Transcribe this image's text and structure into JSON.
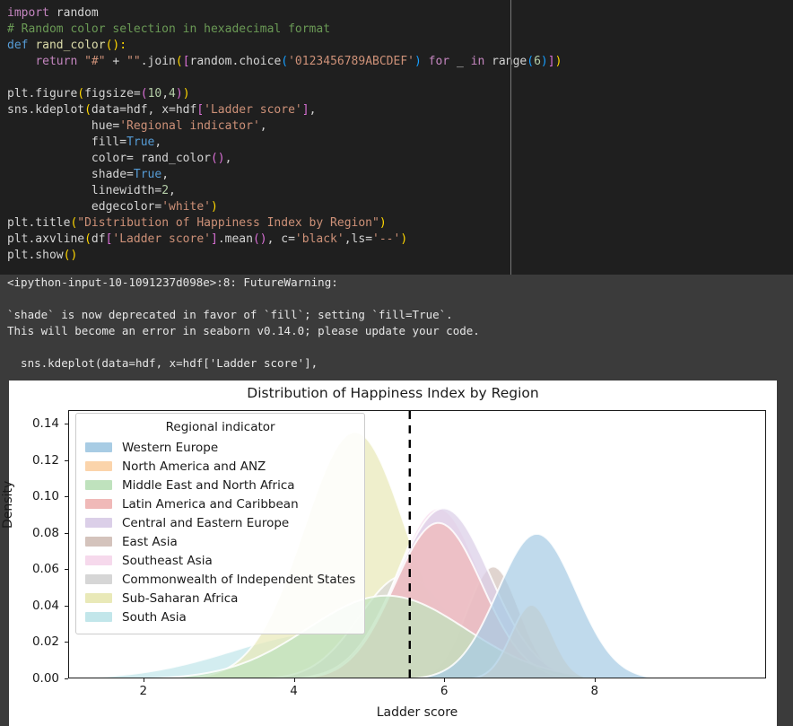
{
  "code_cell": {
    "lines": [
      [
        {
          "t": "import ",
          "c": "tok-kw2"
        },
        {
          "t": "random",
          "c": "tok-plain"
        }
      ],
      [
        {
          "t": "# Random color selection in hexadecimal format",
          "c": "tok-com"
        }
      ],
      [
        {
          "t": "def ",
          "c": "tok-kw"
        },
        {
          "t": "rand_color",
          "c": "tok-fn"
        },
        {
          "t": "():",
          "c": "tok-par1"
        }
      ],
      [
        {
          "t": "    ",
          "c": "tok-plain"
        },
        {
          "t": "return ",
          "c": "tok-kw2"
        },
        {
          "t": "\"#\"",
          "c": "tok-str"
        },
        {
          "t": " + ",
          "c": "tok-plain"
        },
        {
          "t": "\"\"",
          "c": "tok-str"
        },
        {
          "t": ".join",
          "c": "tok-plain"
        },
        {
          "t": "(",
          "c": "tok-par1"
        },
        {
          "t": "[",
          "c": "tok-par2"
        },
        {
          "t": "random.choice",
          "c": "tok-plain"
        },
        {
          "t": "(",
          "c": "tok-par3"
        },
        {
          "t": "'0123456789ABCDEF'",
          "c": "tok-str"
        },
        {
          "t": ")",
          "c": "tok-par3"
        },
        {
          "t": " for ",
          "c": "tok-kw2"
        },
        {
          "t": "_ ",
          "c": "tok-plain"
        },
        {
          "t": "in ",
          "c": "tok-kw2"
        },
        {
          "t": "range",
          "c": "tok-plain"
        },
        {
          "t": "(",
          "c": "tok-par3"
        },
        {
          "t": "6",
          "c": "tok-num"
        },
        {
          "t": ")",
          "c": "tok-par3"
        },
        {
          "t": "]",
          "c": "tok-par2"
        },
        {
          "t": ")",
          "c": "tok-par1"
        }
      ],
      [
        {
          "t": "",
          "c": "tok-plain"
        }
      ],
      [
        {
          "t": "plt.figure",
          "c": "tok-plain"
        },
        {
          "t": "(",
          "c": "tok-par1"
        },
        {
          "t": "figsize=",
          "c": "tok-plain"
        },
        {
          "t": "(",
          "c": "tok-par2"
        },
        {
          "t": "10",
          "c": "tok-num"
        },
        {
          "t": ",",
          "c": "tok-plain"
        },
        {
          "t": "4",
          "c": "tok-num"
        },
        {
          "t": ")",
          "c": "tok-par2"
        },
        {
          "t": ")",
          "c": "tok-par1"
        }
      ],
      [
        {
          "t": "sns.kdeplot",
          "c": "tok-plain"
        },
        {
          "t": "(",
          "c": "tok-par1"
        },
        {
          "t": "data=hdf, x=hdf",
          "c": "tok-plain"
        },
        {
          "t": "[",
          "c": "tok-par2"
        },
        {
          "t": "'Ladder score'",
          "c": "tok-str"
        },
        {
          "t": "]",
          "c": "tok-par2"
        },
        {
          "t": ",",
          "c": "tok-plain"
        }
      ],
      [
        {
          "t": "            hue=",
          "c": "tok-plain"
        },
        {
          "t": "'Regional indicator'",
          "c": "tok-str"
        },
        {
          "t": ",",
          "c": "tok-plain"
        }
      ],
      [
        {
          "t": "            fill=",
          "c": "tok-plain"
        },
        {
          "t": "True",
          "c": "tok-blue"
        },
        {
          "t": ",",
          "c": "tok-plain"
        }
      ],
      [
        {
          "t": "            color= rand_color",
          "c": "tok-plain"
        },
        {
          "t": "()",
          "c": "tok-par2"
        },
        {
          "t": ",",
          "c": "tok-plain"
        }
      ],
      [
        {
          "t": "            shade=",
          "c": "tok-plain"
        },
        {
          "t": "True",
          "c": "tok-blue"
        },
        {
          "t": ",",
          "c": "tok-plain"
        }
      ],
      [
        {
          "t": "            linewidth=",
          "c": "tok-plain"
        },
        {
          "t": "2",
          "c": "tok-num"
        },
        {
          "t": ",",
          "c": "tok-plain"
        }
      ],
      [
        {
          "t": "            edgecolor=",
          "c": "tok-plain"
        },
        {
          "t": "'white'",
          "c": "tok-str"
        },
        {
          "t": ")",
          "c": "tok-par1"
        }
      ],
      [
        {
          "t": "plt.title",
          "c": "tok-plain"
        },
        {
          "t": "(",
          "c": "tok-par1"
        },
        {
          "t": "\"Distribution of Happiness Index by Region\"",
          "c": "tok-str"
        },
        {
          "t": ")",
          "c": "tok-par1"
        }
      ],
      [
        {
          "t": "plt.axvline",
          "c": "tok-plain"
        },
        {
          "t": "(",
          "c": "tok-par1"
        },
        {
          "t": "df",
          "c": "tok-plain"
        },
        {
          "t": "[",
          "c": "tok-par2"
        },
        {
          "t": "'Ladder score'",
          "c": "tok-str"
        },
        {
          "t": "]",
          "c": "tok-par2"
        },
        {
          "t": ".mean",
          "c": "tok-plain"
        },
        {
          "t": "()",
          "c": "tok-par2"
        },
        {
          "t": ", c=",
          "c": "tok-plain"
        },
        {
          "t": "'black'",
          "c": "tok-str"
        },
        {
          "t": ",ls=",
          "c": "tok-plain"
        },
        {
          "t": "'--'",
          "c": "tok-str"
        },
        {
          "t": ")",
          "c": "tok-par1"
        }
      ],
      [
        {
          "t": "plt.show",
          "c": "tok-plain"
        },
        {
          "t": "()",
          "c": "tok-par1"
        }
      ]
    ]
  },
  "warning_output": {
    "line1": "<ipython-input-10-1091237d098e>:8: FutureWarning:",
    "line2": "",
    "line3": "`shade` is now deprecated in favor of `fill`; setting `fill=True`.",
    "line4": "This will become an error in seaborn v0.14.0; please update your code.",
    "line5": "",
    "line6": "  sns.kdeplot(data=hdf, x=hdf['Ladder score'],"
  },
  "chart_data": {
    "type": "area",
    "title": "Distribution of Happiness Index by Region",
    "xlabel": "Ladder score",
    "ylabel": "Density",
    "xlim": [
      1.0,
      10.28
    ],
    "ylim": [
      0.0,
      0.1475
    ],
    "xticks": [
      2,
      4,
      6,
      8
    ],
    "xticklabels": [
      "2",
      "4",
      "6",
      "8"
    ],
    "yticks": [
      0.0,
      0.02,
      0.04,
      0.06,
      0.08,
      0.1,
      0.12,
      0.14
    ],
    "yticklabels": [
      "0.00",
      "0.02",
      "0.04",
      "0.06",
      "0.08",
      "0.10",
      "0.12",
      "0.14"
    ],
    "grid": false,
    "legend_position": "upper left",
    "legend_title": "Regional indicator",
    "edgecolor": "white",
    "linewidth": 2,
    "annotations": [
      {
        "type": "vline",
        "label": "mean ladder score",
        "x": 5.53,
        "color": "#000000",
        "linestyle": "--"
      }
    ],
    "series": [
      {
        "name": "Western Europe",
        "color": "#a8cce4",
        "mean": 7.22,
        "sigma": 0.52,
        "peak_density": 0.08
      },
      {
        "name": "North America and ANZ",
        "color": "#fbd4ab",
        "mean": 7.15,
        "sigma": 0.27,
        "peak_density": 0.041
      },
      {
        "name": "Middle East and North Africa",
        "color": "#bfe2bd",
        "mean": 5.22,
        "sigma": 1.05,
        "peak_density": 0.046
      },
      {
        "name": "Latin America and Caribbean",
        "color": "#f0b9b8",
        "mean": 5.91,
        "sigma": 0.58,
        "peak_density": 0.086
      },
      {
        "name": "Central and Eastern Europe",
        "color": "#dbcfe8",
        "mean": 5.98,
        "sigma": 0.62,
        "peak_density": 0.094
      },
      {
        "name": "East Asia",
        "color": "#d4c3bc",
        "mean": 6.64,
        "sigma": 0.35,
        "peak_density": 0.062
      },
      {
        "name": "Southeast Asia",
        "color": "#f6d9ec",
        "mean": 5.91,
        "sigma": 0.56,
        "peak_density": 0.094
      },
      {
        "name": "Commonwealth of Independent States",
        "color": "#d6d6d6",
        "mean": 5.46,
        "sigma": 0.6,
        "peak_density": 0.057
      },
      {
        "name": "Sub-Saharan Africa",
        "color": "#e9e9b8",
        "mean": 4.8,
        "sigma": 0.68,
        "peak_density": 0.136
      },
      {
        "name": "South Asia",
        "color": "#c2e6ea",
        "mean": 4.44,
        "sigma": 1.25,
        "peak_density": 0.026
      }
    ]
  }
}
